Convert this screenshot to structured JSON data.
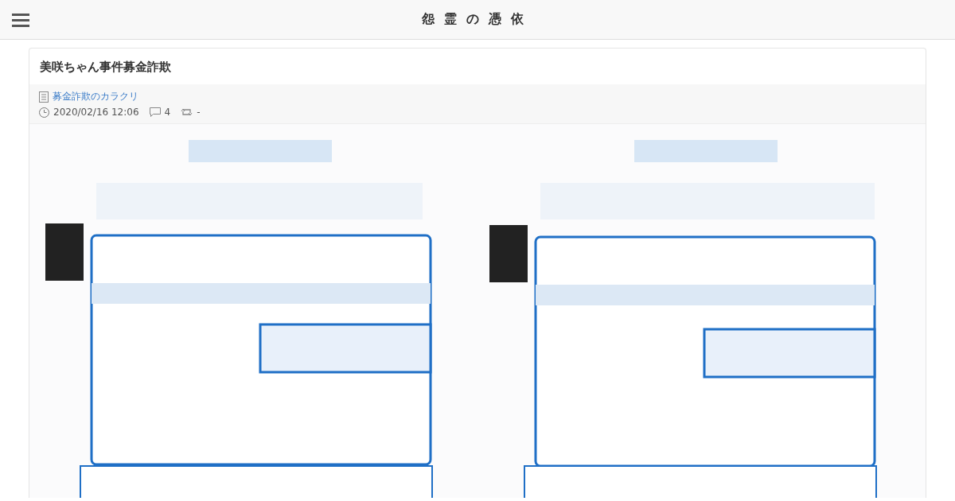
{
  "header": {
    "site_title": "怨霊の憑依"
  },
  "post": {
    "title": "美咲ちゃん事件募金詐欺",
    "category": "募金詐欺のカラクリ",
    "date": "2020/02/16 12:06",
    "comments": "4",
    "shares": "-"
  }
}
